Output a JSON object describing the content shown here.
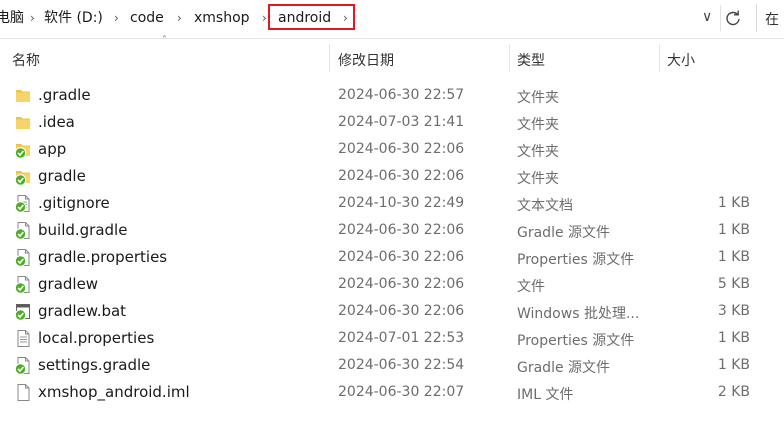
{
  "address": {
    "segments": [
      "电脑",
      "软件 (D:)",
      "code",
      "xmshop",
      "android"
    ],
    "search_text": "在"
  },
  "columns": {
    "name": "名称",
    "date": "修改日期",
    "type": "类型",
    "size": "大小"
  },
  "colors": {
    "highlight_border": "#e0191e",
    "folder": "#f0c346",
    "check_badge": "#4caf23"
  },
  "files": [
    {
      "name": ".gradle",
      "date": "2024-06-30 22:57",
      "type": "文件夹",
      "size": "",
      "icon": "folder-icon"
    },
    {
      "name": ".idea",
      "date": "2024-07-03 21:41",
      "type": "文件夹",
      "size": "",
      "icon": "folder-icon"
    },
    {
      "name": "app",
      "date": "2024-06-30 22:06",
      "type": "文件夹",
      "size": "",
      "icon": "folder-synced-icon"
    },
    {
      "name": "gradle",
      "date": "2024-06-30 22:06",
      "type": "文件夹",
      "size": "",
      "icon": "folder-synced-icon"
    },
    {
      "name": ".gitignore",
      "date": "2024-10-30 22:49",
      "type": "文本文档",
      "size": "1 KB",
      "icon": "text-file-synced-icon"
    },
    {
      "name": "build.gradle",
      "date": "2024-06-30 22:06",
      "type": "Gradle 源文件",
      "size": "1 KB",
      "icon": "file-synced-icon"
    },
    {
      "name": "gradle.properties",
      "date": "2024-06-30 22:06",
      "type": "Properties 源文件",
      "size": "1 KB",
      "icon": "file-synced-icon"
    },
    {
      "name": "gradlew",
      "date": "2024-06-30 22:06",
      "type": "文件",
      "size": "5 KB",
      "icon": "file-synced-icon"
    },
    {
      "name": "gradlew.bat",
      "date": "2024-06-30 22:06",
      "type": "Windows 批处理...",
      "size": "3 KB",
      "icon": "batch-file-synced-icon"
    },
    {
      "name": "local.properties",
      "date": "2024-07-01 22:53",
      "type": "Properties 源文件",
      "size": "1 KB",
      "icon": "text-file-icon"
    },
    {
      "name": "settings.gradle",
      "date": "2024-06-30 22:54",
      "type": "Gradle 源文件",
      "size": "1 KB",
      "icon": "file-synced-icon"
    },
    {
      "name": "xmshop_android.iml",
      "date": "2024-06-30 22:07",
      "type": "IML 文件",
      "size": "2 KB",
      "icon": "blank-file-icon"
    }
  ]
}
